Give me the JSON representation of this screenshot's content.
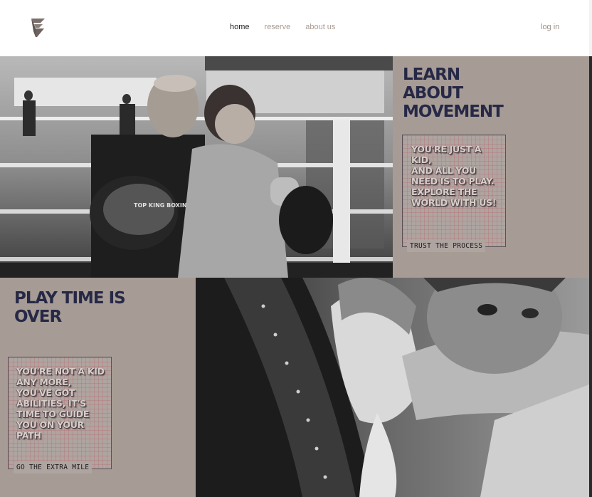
{
  "header": {
    "logo_icon": "brand-logo-icon",
    "nav": [
      {
        "label": "home",
        "active": true
      },
      {
        "label": "reserve",
        "active": false
      },
      {
        "label": "about us",
        "active": false
      }
    ],
    "login_label": "log in"
  },
  "section1": {
    "heading_lines": [
      "LEARN",
      "ABOUT",
      "MOVEMENT"
    ],
    "box_text_lines": [
      "YOU'RE JUST A",
      "KID,",
      "AND ALL YOU",
      "NEED IS TO PLAY.",
      "EXPLORE THE",
      "WORLD WITH US!"
    ],
    "cta": "TRUST THE PROCESS",
    "photo": {
      "brand_text": "TOP KING BOXING"
    }
  },
  "section2": {
    "heading_lines": [
      "PLAY TIME IS",
      "OVER"
    ],
    "box_text_lines": [
      "YOU'RE NOT A KID",
      "ANY MORE,",
      "YOU'VE GOT",
      "ABILITIES, IT'S",
      "TIME TO GUIDE",
      "YOU ON YOUR",
      "PATH"
    ],
    "cta": "GO THE EXTRA MILE"
  },
  "colors": {
    "panel": "#a69c95",
    "heading": "#262846",
    "nav_inactive": "#a79a92",
    "nav_active": "#222222"
  }
}
